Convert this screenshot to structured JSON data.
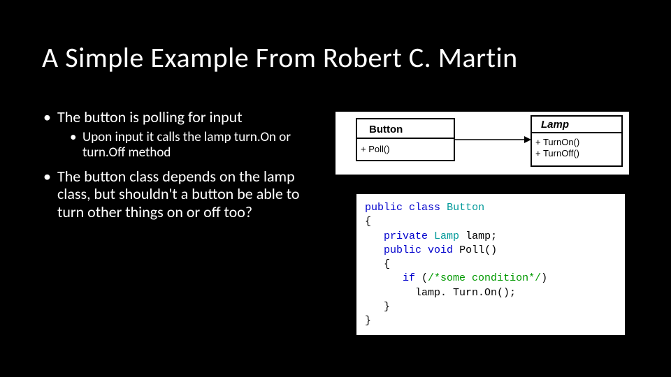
{
  "title": "A Simple Example From Robert C. Martin",
  "bullets": {
    "b1a": "The button is polling for input",
    "b2a": "Upon input it calls the lamp turn.On or turn.Off method",
    "b1b": "The button class depends on the lamp class, but shouldn't a button be able to turn other things on or off too?"
  },
  "uml": {
    "class1_name": "Button",
    "class1_method": "+ Poll()",
    "class2_name": "Lamp",
    "class2_method1": "+ TurnOn()",
    "class2_method2": "+ TurnOff()"
  },
  "code": {
    "t1": "public",
    "t2": " ",
    "t3": "class",
    "t4": " ",
    "t5": "Button",
    "t6": "{",
    "t7": "   ",
    "t8": "private",
    "t9": " ",
    "t10": "Lamp",
    "t11": " lamp;",
    "t12": "   ",
    "t13": "public",
    "t14": " ",
    "t15": "void",
    "t16": " Poll()",
    "t17": "   {",
    "t18": "      ",
    "t19": "if",
    "t20": " (",
    "t21": "/*some condition*/",
    "t22": ")",
    "t23": "        lamp. Turn.On();",
    "t24": "   }",
    "t25": "}"
  }
}
